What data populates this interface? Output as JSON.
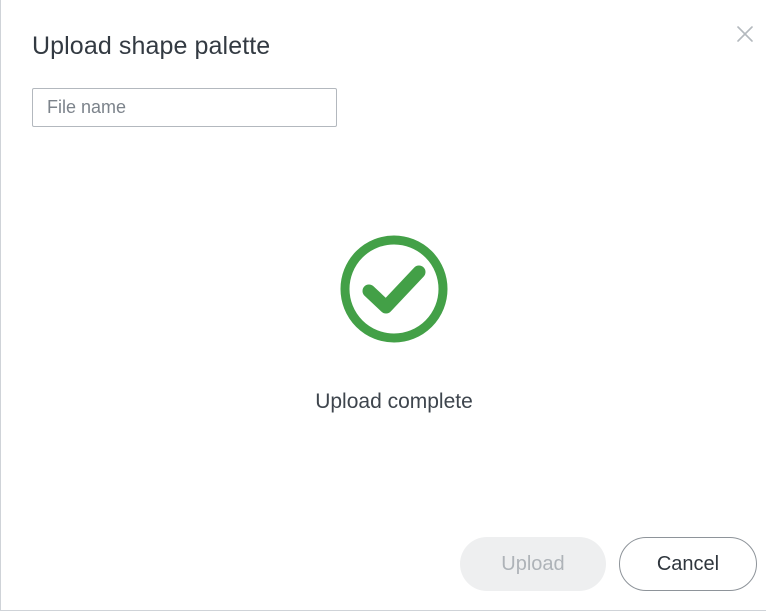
{
  "dialog": {
    "title": "Upload shape palette",
    "close_icon": "close-icon"
  },
  "file_name": {
    "placeholder": "File name",
    "value": ""
  },
  "status": {
    "icon": "check-circle-icon",
    "text": "Upload complete",
    "color": "#43a047"
  },
  "buttons": {
    "upload": "Upload",
    "cancel": "Cancel"
  }
}
